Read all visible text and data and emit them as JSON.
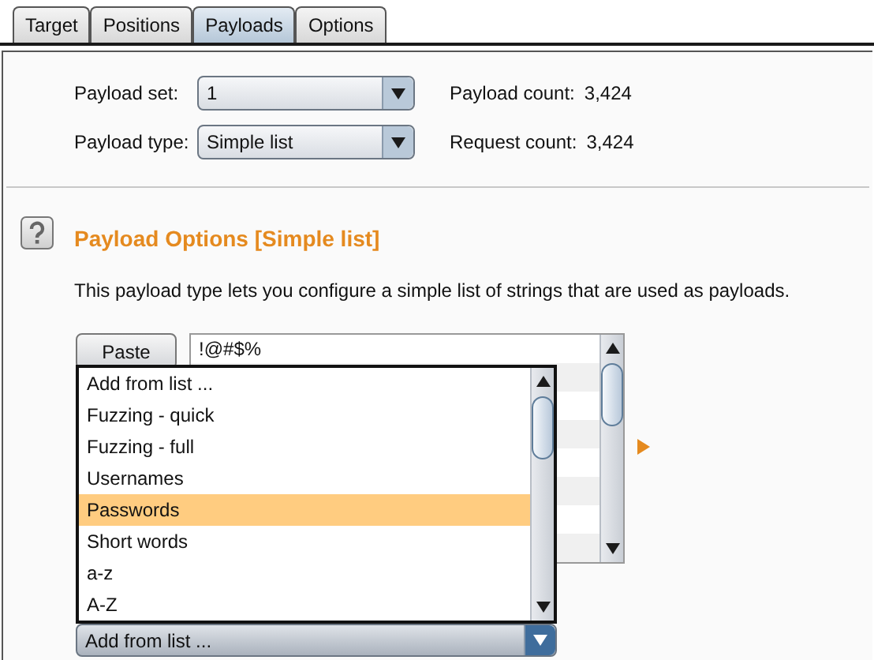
{
  "tabs": [
    {
      "label": "Target",
      "selected": false
    },
    {
      "label": "Positions",
      "selected": false
    },
    {
      "label": "Payloads",
      "selected": true
    },
    {
      "label": "Options",
      "selected": false
    }
  ],
  "payload_set": {
    "label": "Payload set:",
    "value": "1"
  },
  "payload_type": {
    "label": "Payload type:",
    "value": "Simple list"
  },
  "payload_count": {
    "label": "Payload count:",
    "value": "3,424"
  },
  "request_count": {
    "label": "Request count:",
    "value": "3,424"
  },
  "section": {
    "title": "Payload Options [Simple list]",
    "description": "This payload type lets you configure a simple list of strings that are used as payloads."
  },
  "paste_button": "Paste",
  "list_items": [
    "!@#$%"
  ],
  "dropdown_options": [
    {
      "label": "Add from list ...",
      "selected": false
    },
    {
      "label": "Fuzzing - quick",
      "selected": false
    },
    {
      "label": "Fuzzing - full",
      "selected": false
    },
    {
      "label": "Usernames",
      "selected": false
    },
    {
      "label": "Passwords",
      "selected": true
    },
    {
      "label": "Short words",
      "selected": false
    },
    {
      "label": "a-z",
      "selected": false
    },
    {
      "label": "A-Z",
      "selected": false
    }
  ],
  "add_from_list": {
    "value": "Add from list ..."
  }
}
